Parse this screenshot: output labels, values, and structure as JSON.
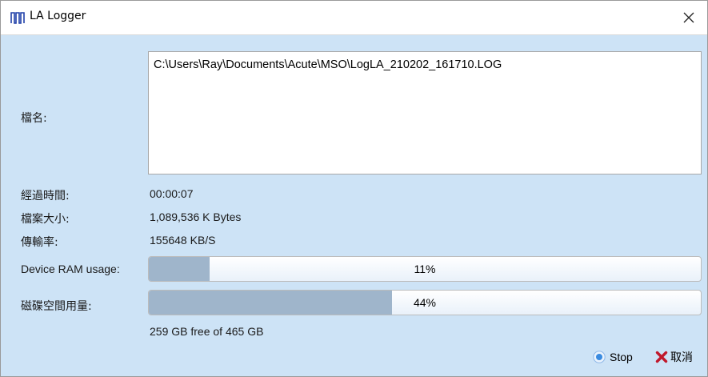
{
  "window": {
    "title": "LA Logger",
    "icons": {
      "app": "waveform-icon",
      "close": "close-icon",
      "stop": "stop-icon",
      "cancel": "cancel-x-icon"
    }
  },
  "fields": {
    "filename_label": "檔名:",
    "filename_value": "C:\\Users\\Ray\\Documents\\Acute\\MSO\\LogLA_210202_161710.LOG",
    "elapsed_label": "經過時間:",
    "elapsed_value": "00:00:07",
    "filesize_label": "檔案大小:",
    "filesize_value": "1,089,536 K Bytes",
    "rate_label": "傳輸率:",
    "rate_value": "155648 KB/S",
    "ram_label": "Device RAM usage:",
    "ram_percent_text": "11%",
    "ram_percent": 11,
    "disk_label": "磁碟空間用量:",
    "disk_percent_text": "44%",
    "disk_percent": 44,
    "disk_free_text": "259 GB free of 465 GB"
  },
  "buttons": {
    "stop_label": "Stop",
    "cancel_label": "取消"
  },
  "colors": {
    "background": "#cde3f6",
    "progress_fill": "#9fb5cb",
    "cancel_icon": "#c0182b",
    "stop_icon": "#3a8be0"
  }
}
